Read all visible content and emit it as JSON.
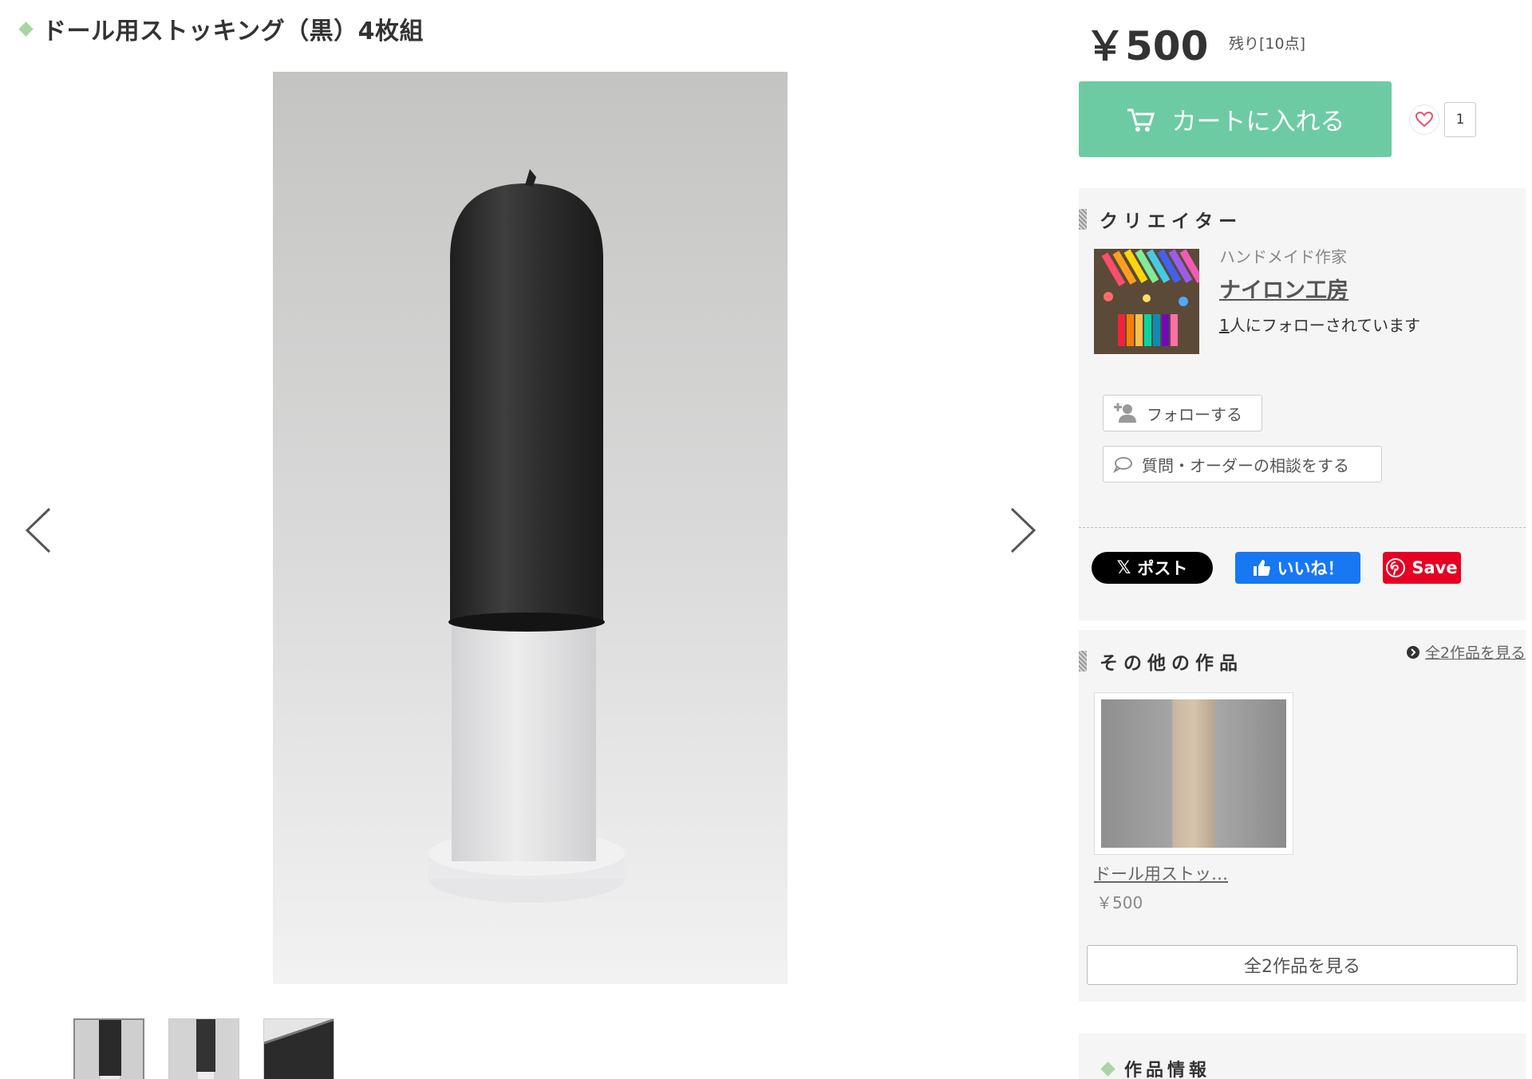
{
  "product": {
    "title": "ドール用ストッキング（黒）4枚組",
    "price": "￥500",
    "stock": "残り[10点]",
    "cart_label": "カートに入れる",
    "like_count": "1"
  },
  "creator": {
    "section_title": "クリエイター",
    "role": "ハンドメイド作家",
    "name": "ナイロン工房",
    "follower_count": "1",
    "follower_suffix": "人にフォローされています",
    "follow_label": "フォローする",
    "ask_label": "質問・オーダーの相談をする"
  },
  "share": {
    "x_label": "ポスト",
    "fb_label": "いいね！",
    "pin_label": "Save"
  },
  "others": {
    "section_title": "その他の作品",
    "see_all_link": "全2作品を見る",
    "items": [
      {
        "title": "ドール用ストッ…",
        "price": "￥500"
      }
    ],
    "see_all_button": "全2作品を見る"
  },
  "info": {
    "section_title": "作品情報"
  },
  "colors": {
    "accent_green": "#6dcba4",
    "diamond_green": "#a8d5a2",
    "x_black": "#000000",
    "facebook_blue": "#1877f2",
    "pinterest_red": "#e60023",
    "panel_bg": "#f5f5f5"
  },
  "icons": {
    "cart": "cart-icon",
    "heart": "heart-icon",
    "follow": "add-user-icon",
    "ask": "speech-bubble-icon",
    "prev": "chevron-left-icon",
    "next": "chevron-right-icon"
  }
}
